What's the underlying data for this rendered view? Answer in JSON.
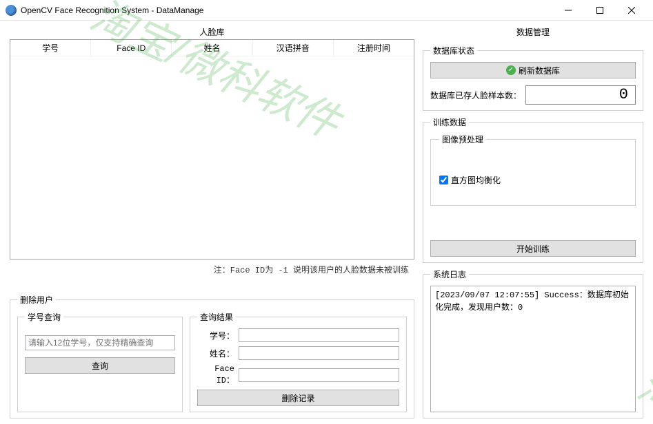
{
  "window": {
    "title": "OpenCV Face Recognition System - DataManage"
  },
  "watermark": "淘宝/微科软件",
  "watermark2": "淘",
  "left": {
    "facelib_title": "人脸库",
    "columns": [
      "学号",
      "Face ID",
      "姓名",
      "汉语拼音",
      "注册时间"
    ],
    "note": "注：Face ID为 -1 说明该用户的人脸数据未被训练"
  },
  "delete": {
    "title": "删除用户",
    "query": {
      "title": "学号查询",
      "placeholder": "请输入12位学号，仅支持精确查询",
      "button": "查询"
    },
    "result": {
      "title": "查询结果",
      "labels": {
        "sid": "学号：",
        "name": "姓名：",
        "faceid": "Face ID："
      },
      "values": {
        "sid": "",
        "name": "",
        "faceid": ""
      },
      "delete_button": "删除记录"
    }
  },
  "right": {
    "title": "数据管理",
    "db": {
      "title": "数据库状态",
      "refresh": "刷新数据库",
      "sample_label": "数据库已存人脸样本数：",
      "sample_count": "0"
    },
    "train": {
      "title": "训练数据",
      "preprocess_title": "图像预处理",
      "hist_eq": "直方图均衡化",
      "start": "开始训练"
    },
    "log": {
      "title": "系统日志",
      "content": "[2023/09/07 12:07:55] Success：数据库初始化完成，发现用户数：0"
    }
  }
}
